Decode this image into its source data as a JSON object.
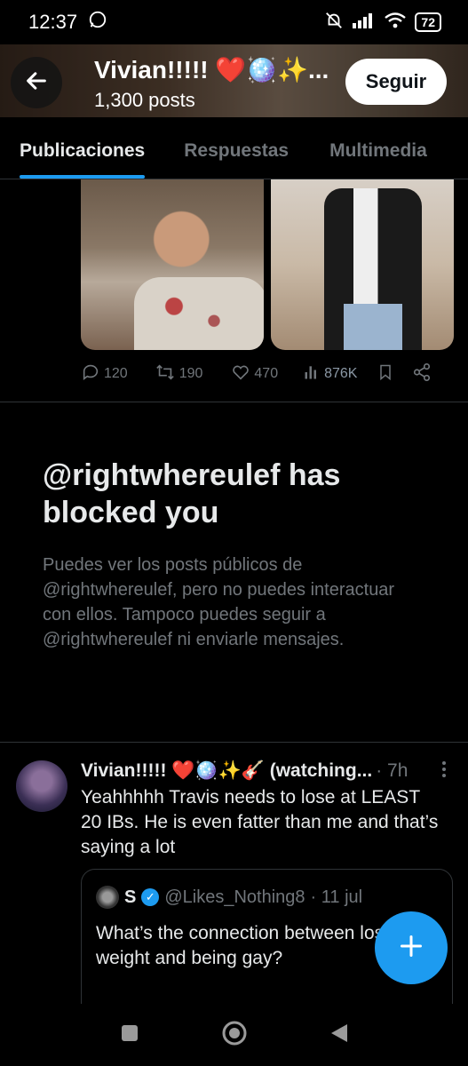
{
  "status_bar": {
    "time": "12:37",
    "battery": "72"
  },
  "header": {
    "name": "Vivian!!!!! ❤️🪩✨...",
    "post_count": "1,300 posts",
    "follow_label": "Seguir"
  },
  "tabs": [
    {
      "label": "Publicaciones",
      "active": true
    },
    {
      "label": "Respuestas",
      "active": false
    },
    {
      "label": "Multimedia",
      "active": false
    }
  ],
  "post_actions": {
    "replies": "120",
    "reposts": "190",
    "likes": "470",
    "views": "876K"
  },
  "blocked": {
    "title": "@rightwhereulef has blocked you",
    "description": "Puedes ver los posts públicos de @rightwhereulef, pero no puedes interactuar con ellos. Tampoco puedes seguir a @rightwhereulef ni enviarle mensajes."
  },
  "tweet": {
    "author": "Vivian!!!!! ❤️🪩✨🎸 (watching...",
    "time": "· 7h",
    "text": "Yeahhhhh Travis needs to lose at LEAST 20 IBs. He is even fatter than me and that’s saying a lot",
    "quote": {
      "name": "S",
      "handle": "@Likes_Nothing8",
      "date": "· 11 jul",
      "text": "What’s the connection between losing weight and being gay?"
    }
  },
  "colors": {
    "accent": "#1d9bf0",
    "muted": "#71767b",
    "text": "#e7e9ea",
    "border": "#2f3336"
  }
}
